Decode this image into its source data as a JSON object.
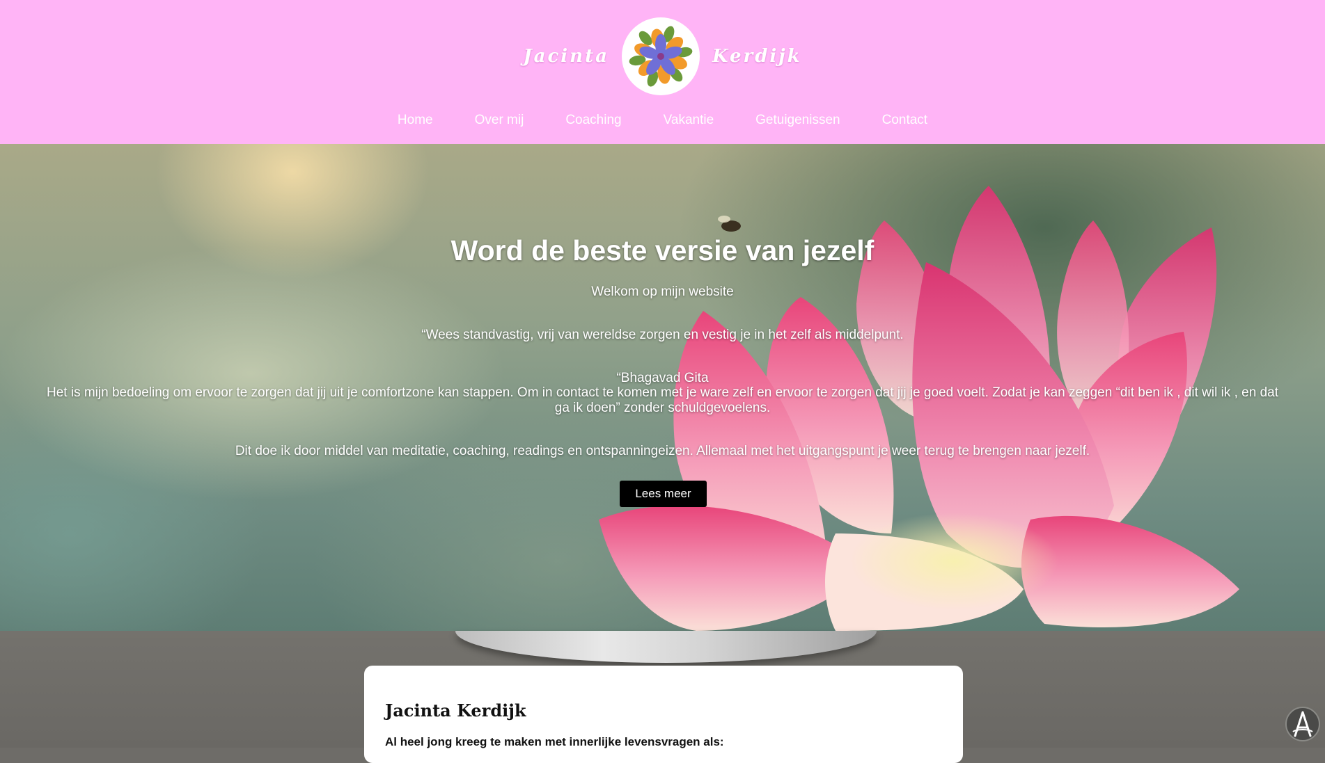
{
  "header": {
    "brand_first": "Jacinta",
    "brand_last": "Kerdijk",
    "logo_icon": "flower-logo-icon",
    "background": "#ffb4f6"
  },
  "nav": {
    "items": [
      {
        "label": "Home"
      },
      {
        "label": "Over mij"
      },
      {
        "label": "Coaching"
      },
      {
        "label": "Vakantie"
      },
      {
        "label": "Getuigenissen"
      },
      {
        "label": "Contact"
      }
    ]
  },
  "hero": {
    "title": "Word de beste versie van jezelf",
    "subtitle": "Welkom op mijn website",
    "quote": "“Wees standvastig, vrij van wereldse zorgen en vestig je in het zelf als middelpunt.",
    "quote_source": "“Bhagavad Gita",
    "paragraph_line1": "Het is mijn bedoeling om ervoor te zorgen dat jij uit je comfortzone kan stappen. Om in contact te komen met je ware zelf en ervoor te zorgen dat jij je goed voelt. Zodat je kan zeggen “dit ben ik , dit wil ik , en dat",
    "paragraph_line2": "ga ik doen” zonder schuldgevoelens.",
    "paragraph2": "Dit doe ik door middel van meditatie, coaching, readings en ontspanningeizen. Allemaal met het uitgangspunt je weer terug te brengen naar jezelf.",
    "cta_label": "Lees meer"
  },
  "card": {
    "title": "Jacinta Kerdijk",
    "text": "Al heel jong kreeg te maken met innerlijke levensvragen als:"
  },
  "accessibility": {
    "icon": "accessibility-icon"
  }
}
